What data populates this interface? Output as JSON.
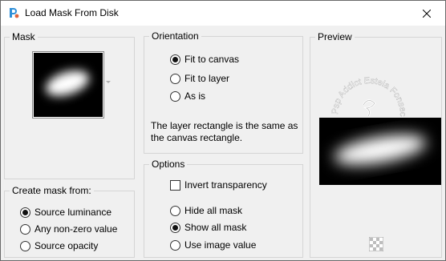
{
  "window": {
    "title": "Load Mask From Disk"
  },
  "mask_group": {
    "label": "Mask"
  },
  "create_group": {
    "label": "Create mask from:",
    "options": [
      {
        "label": "Source luminance",
        "selected": true
      },
      {
        "label": "Any non-zero value",
        "selected": false
      },
      {
        "label": "Source opacity",
        "selected": false
      }
    ]
  },
  "orientation_group": {
    "label": "Orientation",
    "options": [
      {
        "label": "Fit to canvas",
        "selected": true
      },
      {
        "label": "Fit to layer",
        "selected": false
      },
      {
        "label": "As is",
        "selected": false
      }
    ],
    "description_line1": "The layer rectangle is the same as",
    "description_line2": "the canvas rectangle."
  },
  "options_group": {
    "label": "Options",
    "invert_label": "Invert transparency",
    "invert_checked": false,
    "radios": [
      {
        "label": "Hide all mask",
        "selected": false
      },
      {
        "label": "Show all mask",
        "selected": true
      },
      {
        "label": "Use image value",
        "selected": false
      }
    ]
  },
  "preview_group": {
    "label": "Preview",
    "watermark_text": "Psp Addict Estela Fonseca"
  }
}
